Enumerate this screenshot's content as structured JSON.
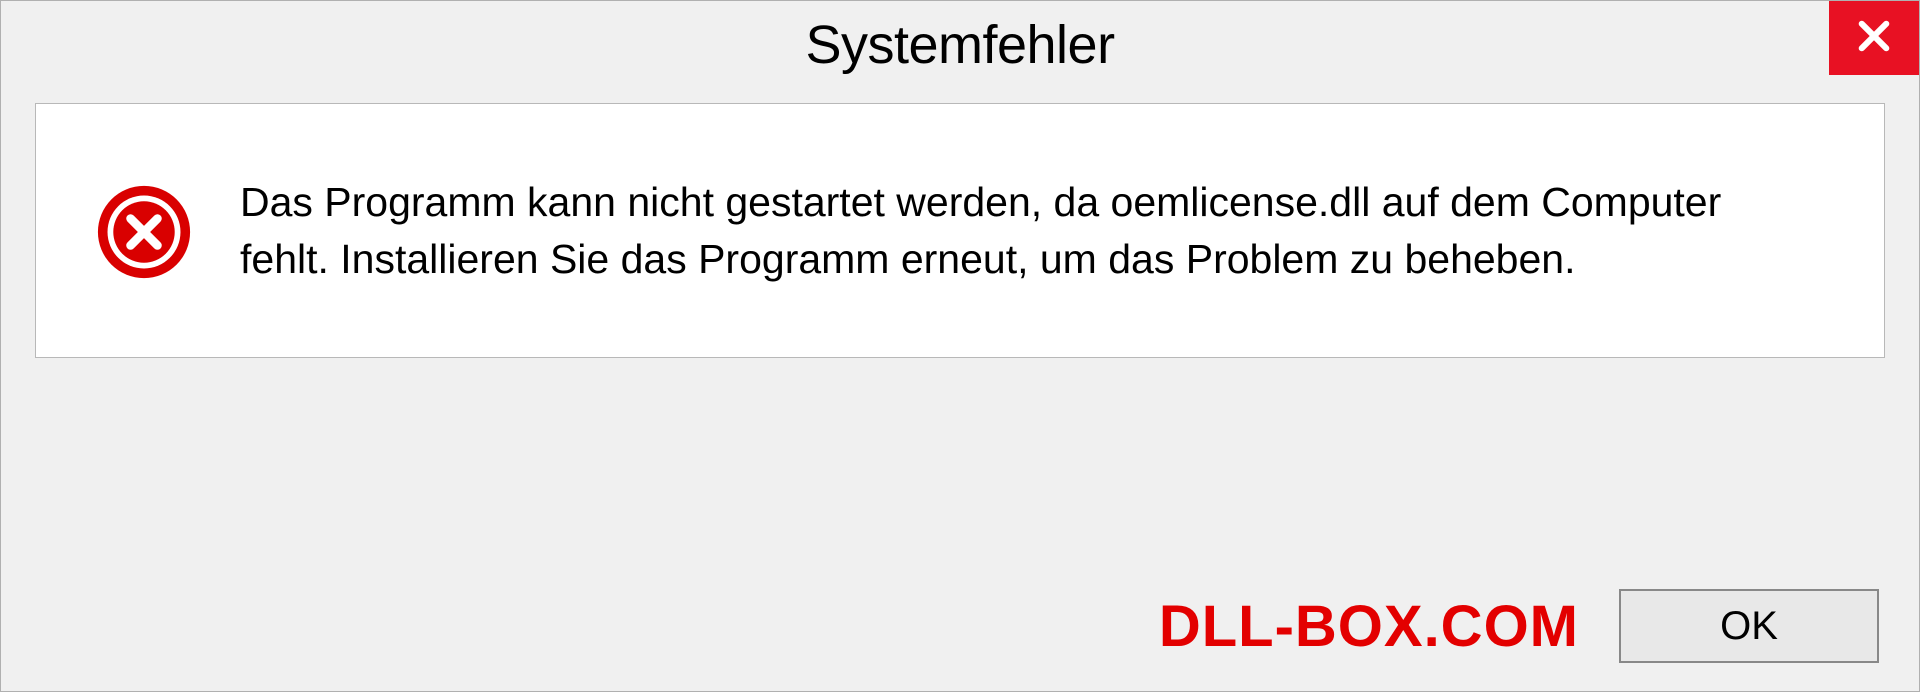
{
  "dialog": {
    "title": "Systemfehler",
    "message": "Das Programm kann nicht gestartet werden, da oemlicense.dll auf dem Computer fehlt. Installieren Sie das Programm erneut, um das Problem zu beheben.",
    "ok_label": "OK"
  },
  "watermark": "DLL-BOX.COM"
}
